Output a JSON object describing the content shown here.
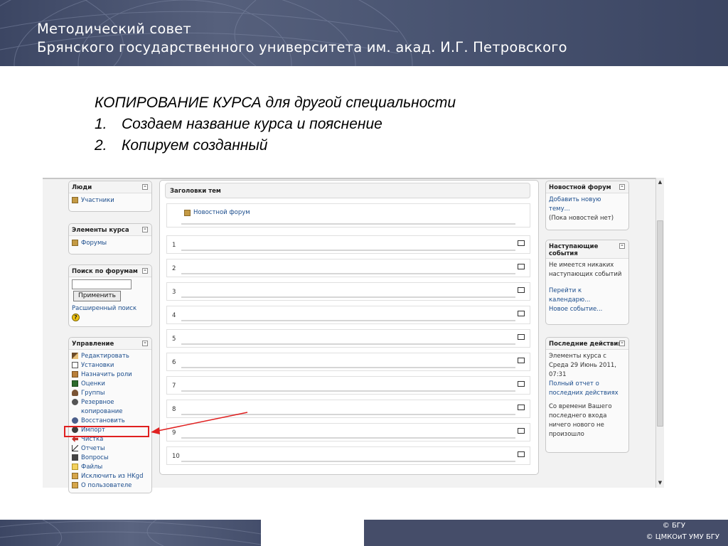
{
  "header": {
    "line1": "Методический совет",
    "line2": "Брянского государственного университета  им. акад. И.Г. Петровского"
  },
  "slide": {
    "heading": "КОПИРОВАНИЕ КУРСА для другой специальности",
    "steps": [
      {
        "num": "1.",
        "text": "Создаем название курса и пояснение"
      },
      {
        "num": "2.",
        "text": "Копируем созданный"
      }
    ]
  },
  "left_blocks": {
    "people": {
      "title": "Люди",
      "items": [
        "Участники"
      ]
    },
    "activities": {
      "title": "Элементы курса",
      "items": [
        "Форумы"
      ]
    },
    "search": {
      "title": "Поиск по форумам",
      "button": "Применить",
      "advanced": "Расширенный поиск"
    },
    "admin": {
      "title": "Управление",
      "items": [
        "Редактировать",
        "Установки",
        "Назначить роли",
        "Оценки",
        "Группы",
        "Резервное",
        "копирование",
        "Восстановить",
        "Импорт",
        "Чистка",
        "Отчеты",
        "Вопросы",
        "Файлы",
        "Исключить из HKgd",
        "О пользователе"
      ]
    }
  },
  "center": {
    "header": "Заголовки тем",
    "news_forum": "Новостной форум",
    "sections": [
      "1",
      "2",
      "3",
      "4",
      "5",
      "6",
      "7",
      "8",
      "9",
      "10"
    ]
  },
  "right_blocks": {
    "news": {
      "title": "Новостной форум",
      "add1": "Добавить новую",
      "add2": "тему...",
      "none": "(Пока новостей нет)"
    },
    "upcoming": {
      "title1": "Наступающие",
      "title2": "события",
      "none1": "Не имеется никаких",
      "none2": "наступающих событий",
      "cal1": "Перейти к",
      "cal2": "календарю...",
      "new_event": "Новое событие..."
    },
    "recent": {
      "title": "Последние действия",
      "l1": "Элементы курса с",
      "l2": "Среда 29 Июнь 2011,",
      "l3": "07:31",
      "link1": "Полный отчет о",
      "link2": "последних действиях",
      "n1": "Со времени Вашего",
      "n2": "последнего входа",
      "n3": "ничего нового не",
      "n4": "произошло"
    }
  },
  "footer": {
    "c1": "© БГУ",
    "c2": "© ЦМКОиТ УМУ БГУ"
  },
  "colors": {
    "banner": "#4b5673",
    "link": "#1a4c8c",
    "highlight": "#e02020"
  }
}
